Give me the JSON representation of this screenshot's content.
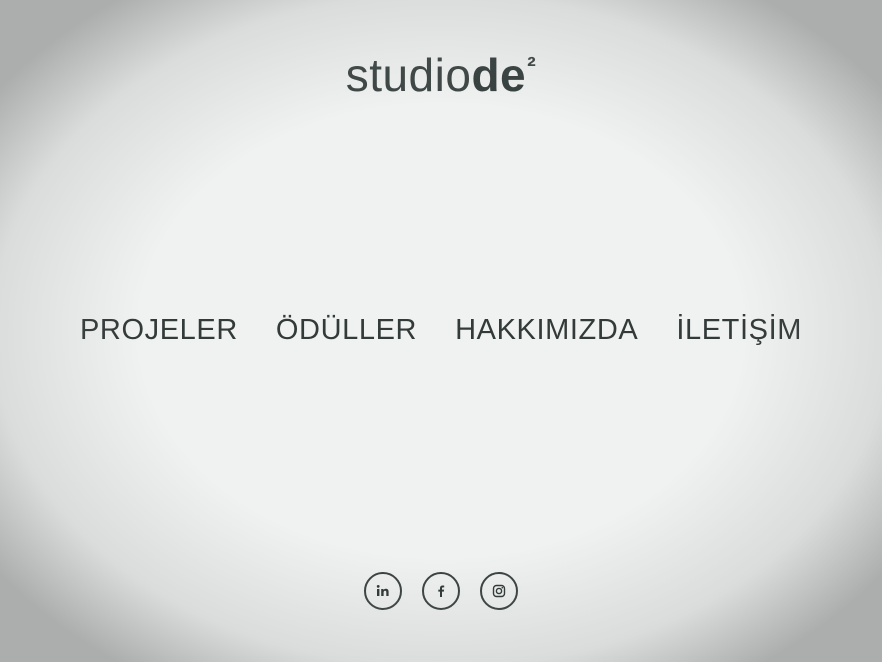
{
  "logo": {
    "light": "studio",
    "bold": "de",
    "sup": "²"
  },
  "nav": {
    "items": [
      {
        "label": "PROJELER"
      },
      {
        "label": "ÖDÜLLER"
      },
      {
        "label": "HAKKIMIZDA"
      },
      {
        "label": "İLETİŞİM"
      }
    ]
  },
  "social": {
    "icons": [
      "linkedin-icon",
      "facebook-icon",
      "instagram-icon"
    ]
  },
  "colors": {
    "background": "#f0f2f2",
    "text": "#333b39"
  }
}
